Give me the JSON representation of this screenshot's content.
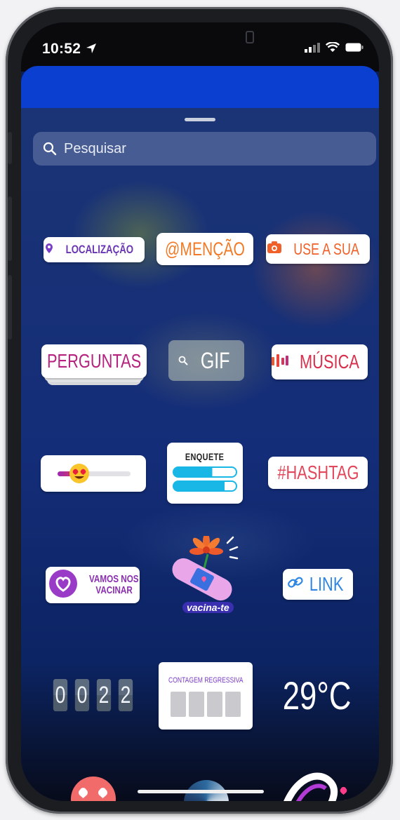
{
  "status_bar": {
    "time": "10:52"
  },
  "search": {
    "placeholder": "Pesquisar"
  },
  "stickers": {
    "location": "LOCALIZAÇÃO",
    "mention": "@MENÇÃO",
    "add_yours": "USE A SUA",
    "questions": "PERGUNTAS",
    "gif": "GIF",
    "music": "MÚSICA",
    "poll_title": "ENQUETE",
    "hashtag": "#HASHTAG",
    "vaccinate_line1": "VAMOS NOS",
    "vaccinate_line2": "VACINAR",
    "vacina_te": "vacina-te",
    "link": "LINK",
    "timer_digits": [
      "0",
      "0",
      "2",
      "2"
    ],
    "countdown_title": "CONTAGEM REGRESSIVA",
    "temperature": "29°C"
  },
  "colors": {
    "accent_blue": "#0a3fd0",
    "sheet_bg": "#142d78",
    "purple": "#6a35b5",
    "orange": "#f16b24",
    "pink": "#c02a80"
  }
}
